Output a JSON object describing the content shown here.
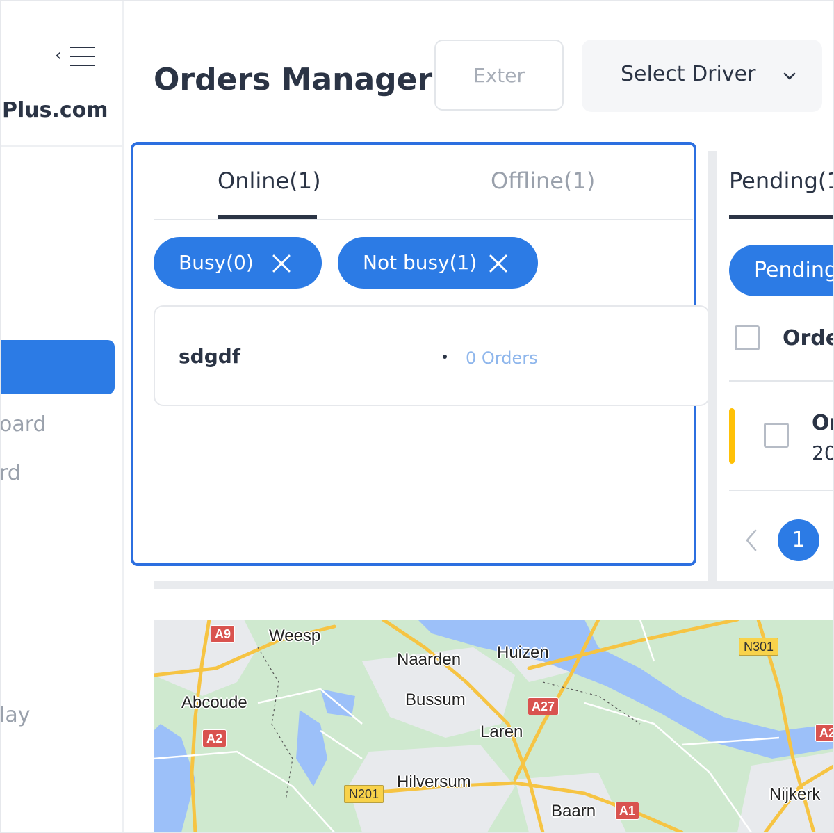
{
  "sidebar": {
    "brand": "Plus.com",
    "items": [
      {
        "label": "oard"
      },
      {
        "label": "rd"
      },
      {
        "label": "lay"
      }
    ]
  },
  "header": {
    "title": "Orders Manager",
    "search_placeholder": "Exter",
    "driver_select_label": "Select Driver"
  },
  "drivers": {
    "tabs": [
      {
        "label": "Online(1)",
        "active": true
      },
      {
        "label": "Offline(1)",
        "active": false
      }
    ],
    "filters": [
      {
        "label": "Busy(0)"
      },
      {
        "label": "Not busy(1)"
      }
    ],
    "list": [
      {
        "name": "sdgdf",
        "orders": "0 Orders"
      }
    ]
  },
  "orders": {
    "tab_label": "Pending(1",
    "filter_chip": "Pending",
    "column_header": "Orde",
    "rows": [
      {
        "title": "Or",
        "date": "20",
        "status_color": "#ffc107"
      }
    ],
    "pagination": {
      "current_page": "1"
    }
  },
  "map": {
    "cities": [
      "Weesp",
      "Naarden",
      "Huizen",
      "Abcoude",
      "Bussum",
      "Laren",
      "Hilversum",
      "Baarn",
      "Nijkerk"
    ],
    "road_labels": [
      "A9",
      "A2",
      "A27",
      "A1",
      "N301",
      "N201",
      "A2"
    ]
  },
  "colors": {
    "accent": "#2c7be5",
    "panel_border": "#2c6fe0",
    "pending_status": "#ffc107",
    "text_primary": "#2b3445",
    "text_muted": "#9aa1ac",
    "orders_link": "#8eb6ec"
  }
}
